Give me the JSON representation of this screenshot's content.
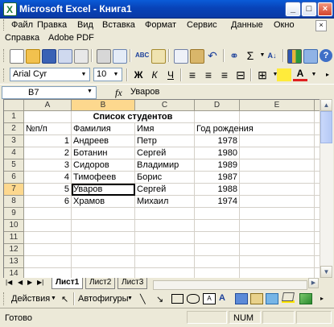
{
  "window": {
    "title": "Microsoft Excel - Книга1",
    "minimize": "_",
    "maximize": "□",
    "close": "×"
  },
  "menu": {
    "row1": [
      "Файл",
      "Правка",
      "Вид",
      "Вставка",
      "Формат",
      "Сервис",
      "Данные",
      "Окно"
    ],
    "row2": [
      "Справка",
      "Adobe PDF"
    ]
  },
  "formatting": {
    "font": "Arial Cyr",
    "size": "10",
    "bold": "Ж",
    "italic": "К",
    "underline": "Ч",
    "font_color_letter": "A"
  },
  "formula_bar": {
    "cell_ref": "B7",
    "fx": "fx",
    "content": "Уваров"
  },
  "columns": [
    "A",
    "B",
    "C",
    "D",
    "E"
  ],
  "rows": [
    "1",
    "2",
    "3",
    "4",
    "5",
    "6",
    "7",
    "8",
    "9",
    "10",
    "11",
    "12",
    "13",
    "14"
  ],
  "sheet": {
    "title": "Список студентов",
    "headers": [
      "№п/п",
      "Фамилия",
      "Имя",
      "Год рождения"
    ],
    "students": [
      {
        "num": "1",
        "surname": "Андреев",
        "name": "Петр",
        "year": "1978"
      },
      {
        "num": "2",
        "surname": "Ботанин",
        "name": "Сергей",
        "year": "1980"
      },
      {
        "num": "3",
        "surname": "Сидоров",
        "name": "Владимир",
        "year": "1989"
      },
      {
        "num": "4",
        "surname": "Тимофеев",
        "name": "Борис",
        "year": "1987"
      },
      {
        "num": "5",
        "surname": "Уваров",
        "name": "Сергей",
        "year": "1988"
      },
      {
        "num": "6",
        "surname": "Храмов",
        "name": "Михаил",
        "year": "1974"
      }
    ]
  },
  "tabs": [
    "Лист1",
    "Лист2",
    "Лист3"
  ],
  "drawing": {
    "actions": "Действия",
    "autoshapes": "Автофигуры"
  },
  "status": {
    "ready": "Готово",
    "num": "NUM"
  },
  "colors": {
    "title_bar": "#0843b8",
    "selected_header": "#fdd88e",
    "chrome": "#ece9d8"
  }
}
